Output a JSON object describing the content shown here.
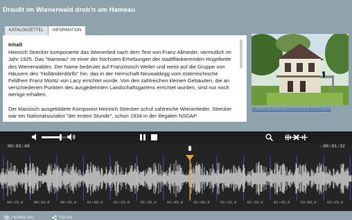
{
  "title": "Draußt im Wienerwald drob'n am Hameau",
  "tabs": [
    "KATALOGZETTEL",
    "INFORMATION"
  ],
  "info": {
    "heading": "Inhalt",
    "p1": "Heinrich Strecker komponierte das Wienerlied nach dem Text von Franz Allmeder, vermutlich im Jahr 1925. Das \"Hameau\" ist einer der höchsten Erhebungen der stadtflankierenden Hügelkette des Wienerwaldes. Der Name bedeutet auf Französisch Weiler und weist auf die Gruppe von Häusern des \"Holländerdörfls\" hin, das in der Herrschaft Neuwaldegg vom österreichische Feldherr Franz Moritz von Lacy errichtet wurde. Von den zahlreichen kleinen Gebäuden, die an verschiedenen Punkten des ausgedehnten Landschaftsgartens errichtet wurden, sind nur noch wenige erhalten.",
    "p2": "Der klassisch ausgebildete Komponist Heinrich Strecker schuf zahlreiche Wienerlieder. Strecker war ein Nationalsozialist \"der ersten Stunde\", schon 1934 in der illegalen NSDAP"
  },
  "image_credit": "Bild: CC BY-SA 3.0 AT: Österreichische Mediathek 2015",
  "player": {
    "time_start": "00:01:49",
    "time_end": "-00:01:32",
    "volume": 0.75,
    "progress": 0.54,
    "ticks": [
      "00:15,0",
      "00:30,0",
      "00:45,0",
      "01:00,0",
      "01:15,0",
      "01:30,0",
      "01:45,0",
      "02:00,0",
      "02:15,0",
      "02:30,0",
      "02:45,0",
      "03:00,0",
      "03:15,0"
    ]
  },
  "footer": {
    "permalink": "PERMA-URL",
    "share": "TEILEN"
  },
  "colors": {
    "accent": "#f0a030",
    "marker_line": "#3c4fb4",
    "waveform": "#f2f2f2"
  }
}
